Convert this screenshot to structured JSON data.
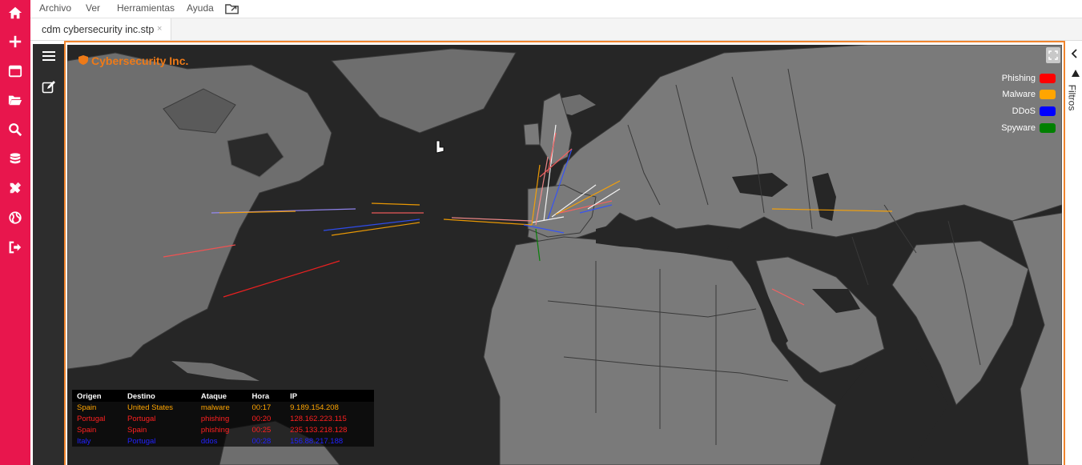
{
  "sidebar": {
    "items": [
      {
        "icon": "home-icon"
      },
      {
        "icon": "plus-icon"
      },
      {
        "icon": "window-icon"
      },
      {
        "icon": "folder-open-icon"
      },
      {
        "icon": "search-icon"
      },
      {
        "icon": "database-icon"
      },
      {
        "icon": "tools-icon"
      },
      {
        "icon": "globe-icon"
      },
      {
        "icon": "sign-out-icon"
      }
    ],
    "accent": "#e8164d"
  },
  "menubar": {
    "items": [
      "Archivo",
      "Ver",
      "Herramientas",
      "Ayuda"
    ],
    "export_icon": "folder-export-icon"
  },
  "tabs": [
    {
      "label": "cdm cybersecurity inc.stp",
      "close": "×"
    }
  ],
  "panel": {
    "menu_icon": "hamburger-icon",
    "edit_icon": "edit-icon"
  },
  "map": {
    "title": "Cybersecurity Inc.",
    "title_color": "#ee7a18",
    "legend": [
      {
        "label": "Phishing",
        "color": "#ff0000"
      },
      {
        "label": "Malware",
        "color": "#ffa500"
      },
      {
        "label": "DDoS",
        "color": "#0000ff"
      },
      {
        "label": "Spyware",
        "color": "#008000"
      }
    ]
  },
  "attack_table": {
    "headers": [
      "Origen",
      "Destino",
      "Ataque",
      "Hora",
      "IP"
    ],
    "rows": [
      {
        "origen": "Spain",
        "destino": "United States",
        "ataque": "malware",
        "hora": "00:17",
        "ip": "9.189.154.208",
        "color": "#ffa500"
      },
      {
        "origen": "Portugal",
        "destino": "Portugal",
        "ataque": "phishing",
        "hora": "00:20",
        "ip": "128.162.223.115",
        "color": "#ff2020"
      },
      {
        "origen": "Spain",
        "destino": "Spain",
        "ataque": "phishing",
        "hora": "00:25",
        "ip": "235.133.218.128",
        "color": "#ff2020"
      },
      {
        "origen": "Italy",
        "destino": "Portugal",
        "ataque": "ddos",
        "hora": "00:28",
        "ip": "156.88.217.188",
        "color": "#2222ff"
      }
    ]
  },
  "right_panel": {
    "label": "Filtros"
  }
}
